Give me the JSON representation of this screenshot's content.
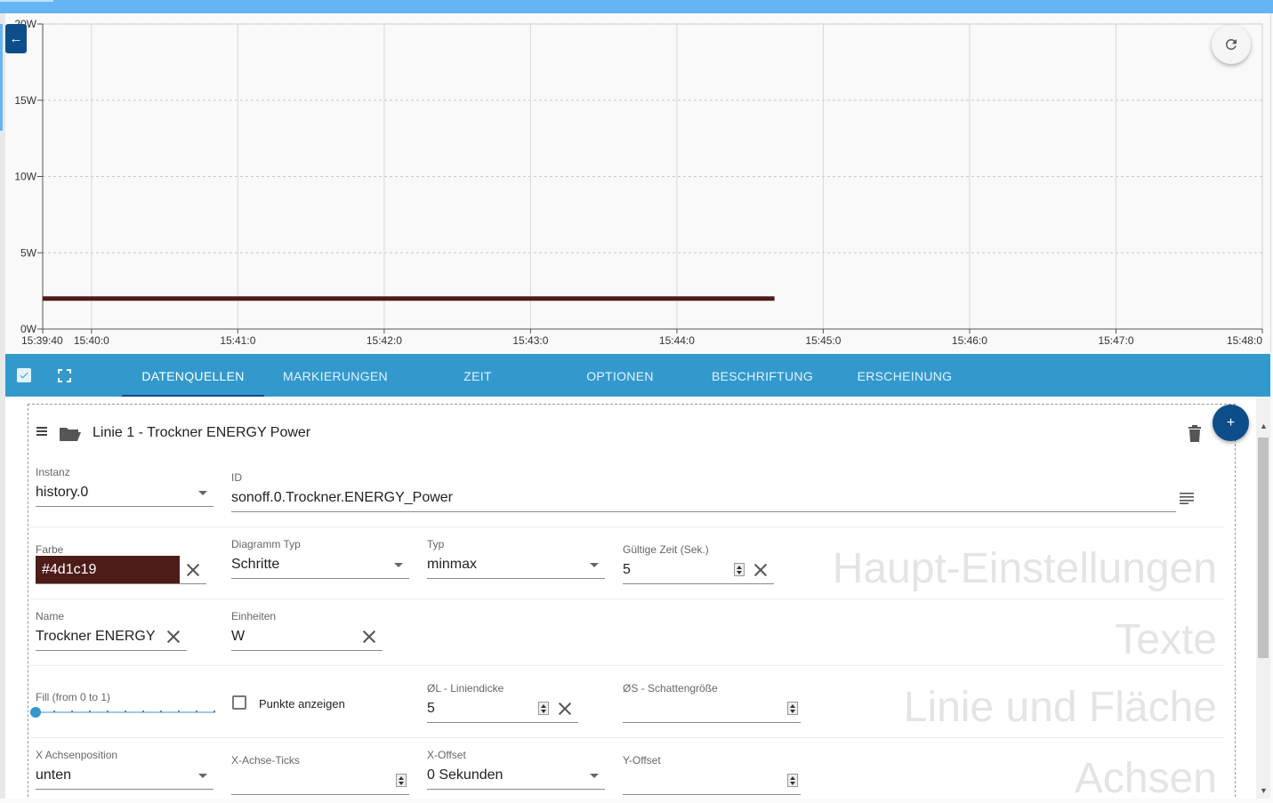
{
  "chart_data": {
    "type": "line",
    "step": true,
    "y_ticks": [
      "0W",
      "5W",
      "10W",
      "15W",
      "20W"
    ],
    "y_range": [
      0,
      20
    ],
    "x_ticks": [
      "15:39:40",
      "15:40:0",
      "15:41:0",
      "15:42:0",
      "15:43:0",
      "15:44:0",
      "15:45:0",
      "15:46:0",
      "15:47:0",
      "15:48:0"
    ],
    "series": [
      {
        "color": "#4d1c19",
        "x": [
          "15:39:40",
          "15:44:40"
        ],
        "y": [
          2,
          2
        ]
      }
    ],
    "grid": true
  },
  "header": {
    "refresh_icon": "refresh-icon",
    "back_icon": "arrow-left-icon"
  },
  "tabs": [
    {
      "label": "DATENQUELLEN",
      "active": true
    },
    {
      "label": "MARKIERUNGEN"
    },
    {
      "label": "ZEIT"
    },
    {
      "label": "OPTIONEN"
    },
    {
      "label": "BESCHRIFTUNG"
    },
    {
      "label": "ERSCHEINUNG"
    }
  ],
  "line": {
    "title": "Linie 1 - Trockner ENERGY Power",
    "instanz_label": "Instanz",
    "instanz_value": "history.0",
    "id_label": "ID",
    "id_value": "sonoff.0.Trockner.ENERGY_Power",
    "farbe_label": "Farbe",
    "farbe_value": "#4d1c19",
    "diagramm_typ_label": "Diagramm Typ",
    "diagramm_typ_value": "Schritte",
    "typ_label": "Typ",
    "typ_value": "minmax",
    "gueltige_zeit_label": "Gültige Zeit (Sek.)",
    "gueltige_zeit_value": "5",
    "name_label": "Name",
    "name_value": "Trockner ENERGY",
    "einheiten_label": "Einheiten",
    "einheiten_value": "W",
    "fill_label": "Fill (from 0 to 1)",
    "fill_value": 0,
    "punkte_label": "Punkte anzeigen",
    "liniendicke_label": "ØL - Liniendicke",
    "liniendicke_value": "5",
    "schatten_label": "ØS - Schattengröße",
    "x_achsenposition_label": "X Achsenposition",
    "x_achsenposition_value": "unten",
    "x_achse_ticks_label": "X-Achse-Ticks",
    "x_offset_label": "X-Offset",
    "x_offset_value": "0 Sekunden",
    "y_offset_label": "Y-Offset"
  },
  "sections": [
    "Haupt-Einstellungen",
    "Texte",
    "Linie und Fläche",
    "Achsen"
  ],
  "fab_label": "+"
}
